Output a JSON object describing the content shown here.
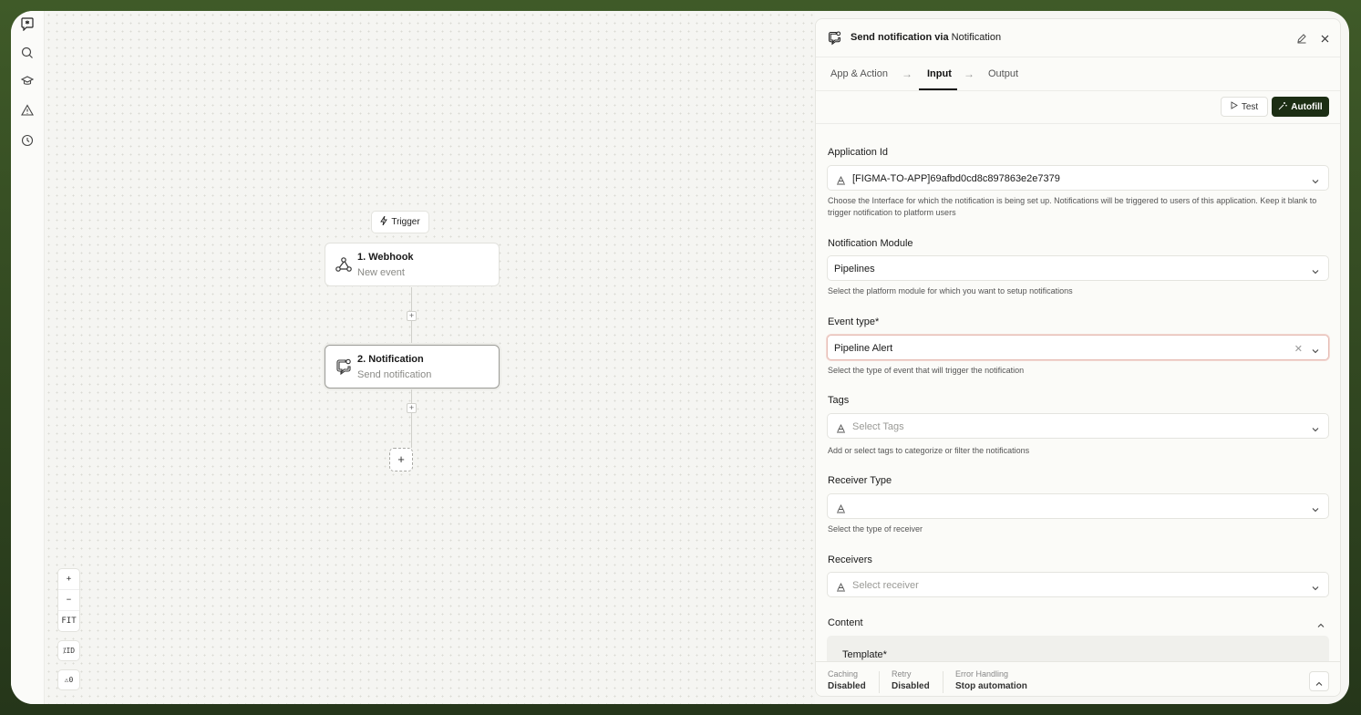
{
  "canvas": {
    "trigger_label": "Trigger",
    "nodes": [
      {
        "title": "1. Webhook",
        "subtitle": "New event"
      },
      {
        "title": "2. Notification",
        "subtitle": "Send notification"
      }
    ],
    "add_step": "+",
    "zoom_in": "+",
    "zoom_out": "−",
    "fit": "FIT",
    "id_toggle": "ID",
    "warnings_count": "0"
  },
  "panel": {
    "title_prefix": "Send notification via",
    "title_app": "Notification",
    "tabs": [
      {
        "label": "App & Action"
      },
      {
        "label": "Input",
        "active": true
      },
      {
        "label": "Output"
      }
    ],
    "test_button": "Test",
    "autofill_button": "Autofill",
    "fields": [
      {
        "label": "Application Id",
        "value": "[FIGMA-TO-APP]69afbd0cd8c897863e2e7379",
        "placeholder": "",
        "help": "Choose the Interface for which the notification is being set up. Notifications will be triggered to users of this application. Keep it blank to trigger notification to platform users"
      },
      {
        "label": "Notification Module",
        "value": "Pipelines",
        "placeholder": "",
        "help": "Select the platform module for which you want to setup notifications"
      },
      {
        "label": "Event type*",
        "value": "Pipeline Alert",
        "placeholder": "",
        "help": "Select the type of event that will trigger the notification"
      },
      {
        "label": "Tags",
        "value": "",
        "placeholder": "Select Tags",
        "help": "Add or select tags to categorize or filter the notifications"
      },
      {
        "label": "Receiver Type",
        "value": "",
        "placeholder": "",
        "help": "Select the type of receiver"
      },
      {
        "label": "Receivers",
        "value": "",
        "placeholder": "Select receiver",
        "help": ""
      }
    ],
    "content_label": "Content",
    "template_label": "Template*",
    "footer": {
      "caching_label": "Caching",
      "caching_value": "Disabled",
      "retry_label": "Retry",
      "retry_value": "Disabled",
      "error_label": "Error Handling",
      "error_value": "Stop automation"
    }
  },
  "colors": {
    "accent_dark": "#1c2e14",
    "frame_bg": "#3f5a28"
  }
}
